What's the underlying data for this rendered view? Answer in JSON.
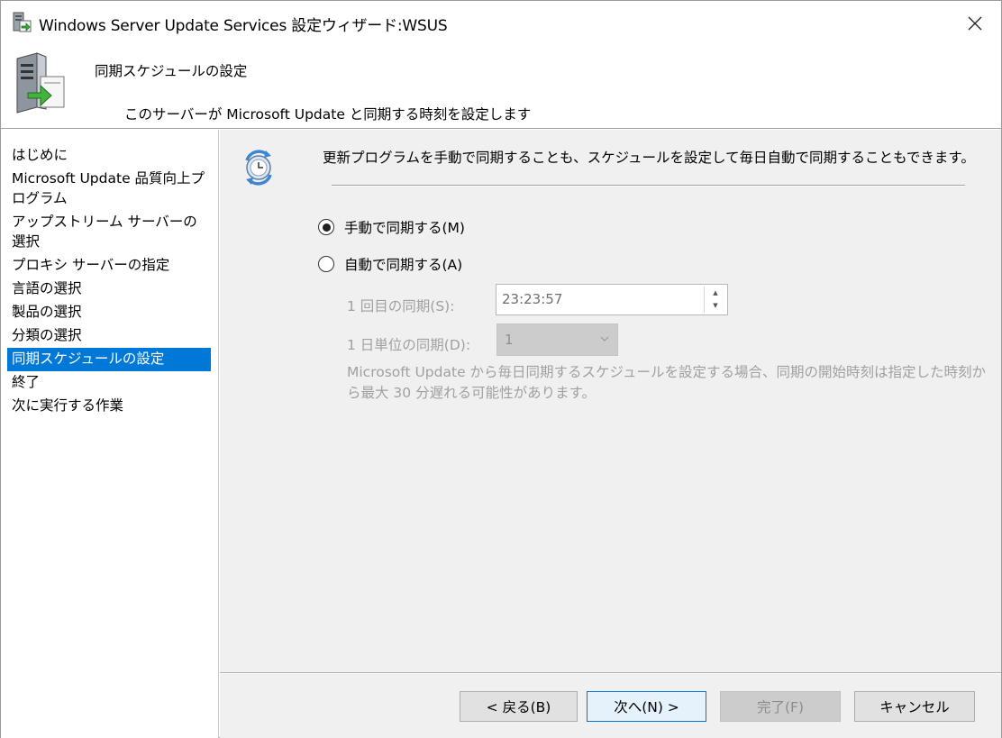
{
  "window": {
    "title": "Windows Server Update Services 設定ウィザード:WSUS"
  },
  "header": {
    "title": "同期スケジュールの設定",
    "subtitle": "このサーバーが Microsoft Update と同期する時刻を設定します"
  },
  "nav": {
    "items": [
      {
        "label": "はじめに",
        "active": false
      },
      {
        "label": "Microsoft Update 品質向上プログラム",
        "active": false
      },
      {
        "label": "アップストリーム サーバーの選択",
        "active": false
      },
      {
        "label": "プロキシ サーバーの指定",
        "active": false
      },
      {
        "label": "言語の選択",
        "active": false
      },
      {
        "label": "製品の選択",
        "active": false
      },
      {
        "label": "分類の選択",
        "active": false
      },
      {
        "label": "同期スケジュールの設定",
        "active": true
      },
      {
        "label": "終了",
        "active": false
      },
      {
        "label": "次に実行する作業",
        "active": false
      }
    ]
  },
  "content": {
    "intro": "更新プログラムを手動で同期することも、スケジュールを設定して毎日自動で同期することもできます。",
    "radio_manual": {
      "label": "手動で同期する(M)",
      "checked": true
    },
    "radio_auto": {
      "label": "自動で同期する(A)",
      "checked": false
    },
    "first_sync": {
      "label": "1 回目の同期(S):",
      "value": "23:23:57"
    },
    "daily_sync": {
      "label": "1 日単位の同期(D):",
      "value": "1"
    },
    "note": "Microsoft Update から毎日同期するスケジュールを設定する場合、同期の開始時刻は指定した時刻から最大 30 分遅れる可能性があります。"
  },
  "buttons": {
    "back": "< 戻る(B)",
    "next": "次へ(N) >",
    "finish": "完了(F)",
    "cancel": "キャンセル"
  },
  "colors": {
    "selection": "#0078d7",
    "content_bg": "#f0f0f0",
    "disabled_text": "#a0a0a0"
  },
  "icons": {
    "title": "wsus-server-icon",
    "header": "server-update-icon",
    "content": "sync-clock-icon",
    "close": "close-icon"
  }
}
